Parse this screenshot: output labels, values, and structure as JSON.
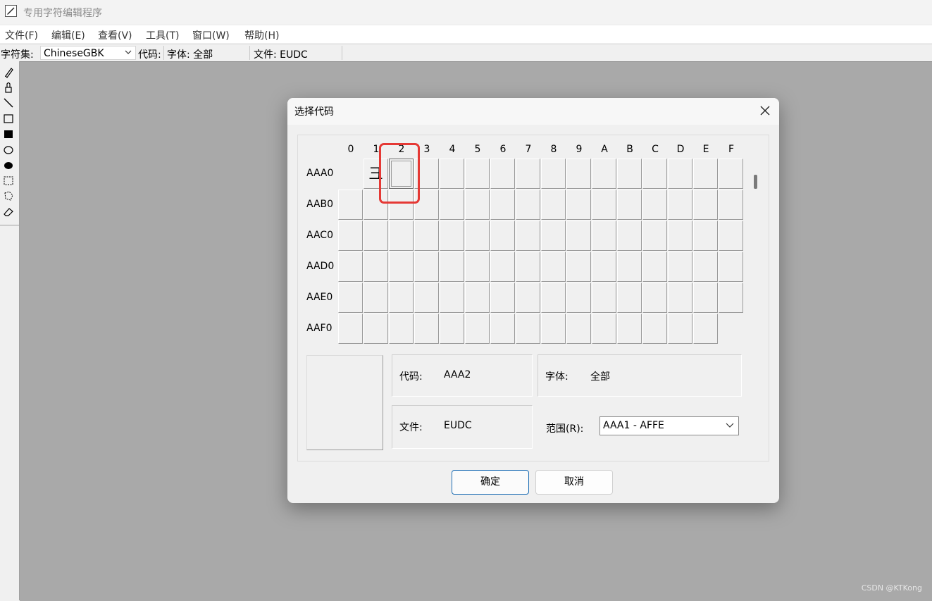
{
  "window": {
    "title": "专用字符编辑程序"
  },
  "menu": [
    "文件(F)",
    "编辑(E)",
    "查看(V)",
    "工具(T)",
    "窗口(W)",
    "帮助(H)"
  ],
  "toolbar": {
    "charset_label": "字符集:",
    "charset_value": "ChineseGBK",
    "code_label": "代码:",
    "font_label": "字体: 全部",
    "file_label": "文件: EUDC"
  },
  "tools": [
    "pencil-icon",
    "brush-icon",
    "line-icon",
    "hollow-rect-icon",
    "filled-rect-icon",
    "hollow-ellipse-icon",
    "filled-ellipse-icon",
    "rect-select-icon",
    "freeform-select-icon",
    "eraser-icon"
  ],
  "dialog": {
    "title": "选择代码",
    "columns": [
      "0",
      "1",
      "2",
      "3",
      "4",
      "5",
      "6",
      "7",
      "8",
      "9",
      "A",
      "B",
      "C",
      "D",
      "E",
      "F"
    ],
    "rows": [
      "AAA0",
      "AAB0",
      "AAC0",
      "AAD0",
      "AAE0",
      "AAF0"
    ],
    "glyph_cell": {
      "row": 0,
      "col": 1,
      "char": "⼹"
    },
    "selected_cell": {
      "row": 0,
      "col": 2
    },
    "code_label": "代码:",
    "code_value": "AAA2",
    "font_label": "字体:",
    "font_value": "全部",
    "file_label": "文件:",
    "file_value": "EUDC",
    "range_label": "范围(R):",
    "range_value": "AAA1 - AFFE",
    "ok_label": "确定",
    "cancel_label": "取消"
  },
  "watermark": "CSDN @KTKong"
}
